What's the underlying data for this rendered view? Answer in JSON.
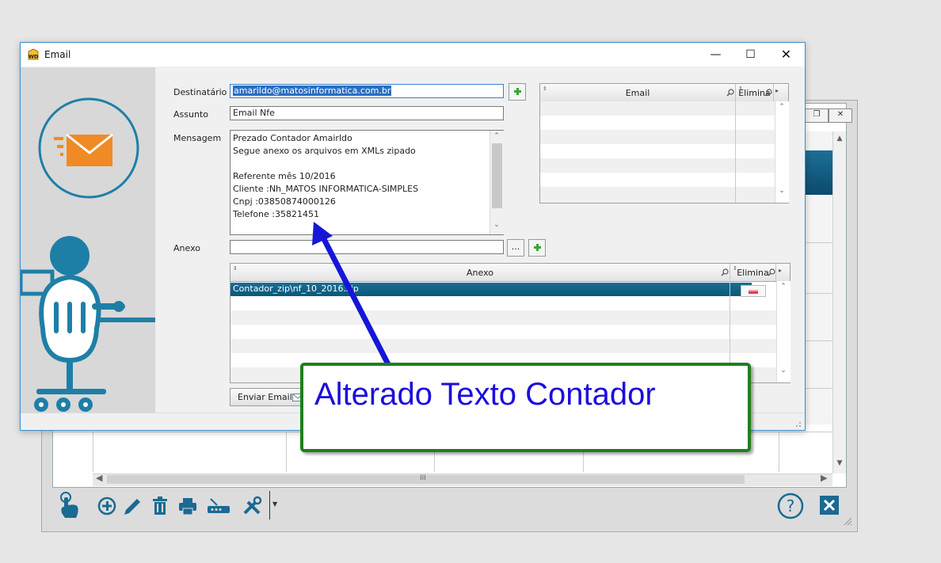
{
  "dialog": {
    "title": "Email",
    "labels": {
      "destinatario": "Destinatário",
      "assunto": "Assunto",
      "mensagem": "Mensagem",
      "anexo": "Anexo"
    },
    "fields": {
      "destinatario": "amarildo@matosinformatica.com.br",
      "assunto": "Email Nfe",
      "anexo": ""
    },
    "message_lines": [
      "Prezado Contador Amairldo",
      "Segue anexo os arquivos em XMLs  zipado",
      "",
      "Referente mês 10/2016",
      "Cliente :Nh_MATOS INFORMATICA-SIMPLES",
      "Cnpj  :03850874000126",
      "Telefone  :35821451"
    ],
    "browse_button": "...",
    "email_grid": {
      "col_email": "Email",
      "col_elimina": "Elimina"
    },
    "anexo_grid": {
      "col_anexo": "Anexo",
      "col_elimina": "Elimina",
      "rows": [
        "Contador_zip\\nf_10_2016.zip"
      ]
    },
    "send_button": "Enviar Email"
  },
  "background_window": {
    "hscroll_label": "III"
  },
  "callout": {
    "text": "Alterado Texto Contador"
  },
  "colors": {
    "accent_blue": "#2a6fc2",
    "grid_selection": "#0b5e86",
    "brand_teal": "#1e7fa6",
    "envelope_orange": "#f08a24",
    "callout_border": "#1e7f1e",
    "callout_text": "#1c0ddc",
    "arrow": "#1616d8"
  },
  "icons": {
    "app_icon": "wd-app-icon",
    "add": "green-plus-icon",
    "eraser": "eraser-icon",
    "search": "magnifier-icon"
  }
}
